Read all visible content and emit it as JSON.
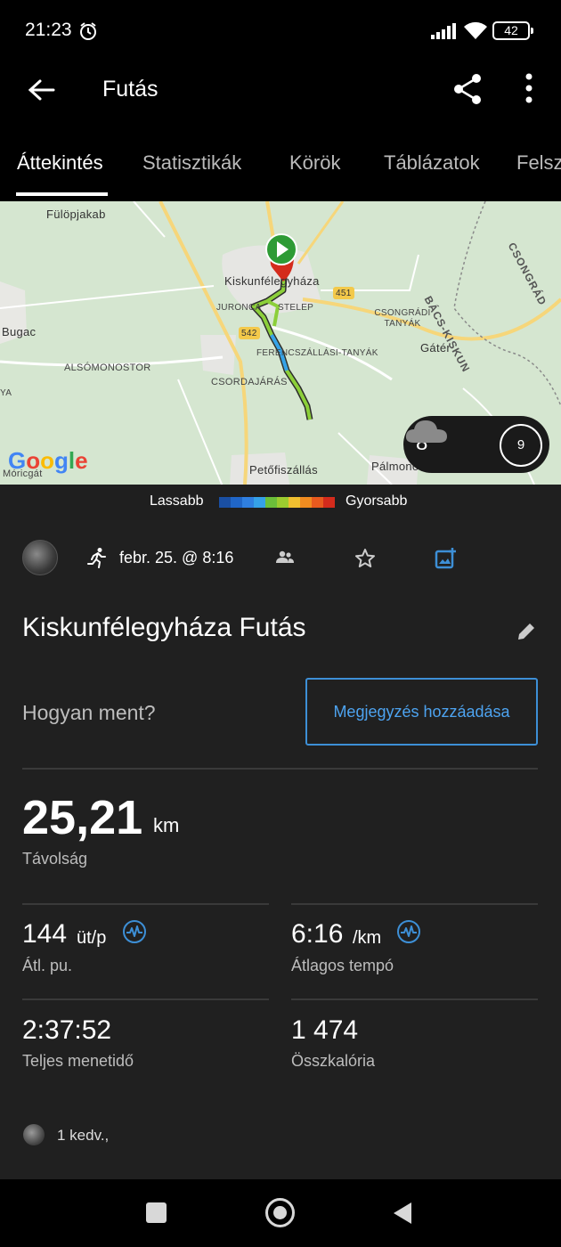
{
  "status": {
    "time": "21:23",
    "battery": "42",
    "alarm_icon": "alarm-clock-icon",
    "signal_icon": "signal-icon",
    "wifi_icon": "wifi-icon"
  },
  "appbar": {
    "title": "Futás",
    "back_icon": "arrow-left-icon",
    "share_icon": "share-icon",
    "more_icon": "more-vertical-icon"
  },
  "tabs": [
    {
      "label": "Áttekintés",
      "active": true
    },
    {
      "label": "Statisztikák",
      "active": false
    },
    {
      "label": "Körök",
      "active": false
    },
    {
      "label": "Táblázatok",
      "active": false
    },
    {
      "label": "Felsz",
      "active": false
    }
  ],
  "map": {
    "labels": {
      "fulopjakab": "Fülöpjakab",
      "kiskunfelegyhaza": "Kiskunfélegyháza",
      "juronca": "JURONCA",
      "telep": "STELEP",
      "bugac": "Bugac",
      "alsomonostor": "ALSÓMONOSTOR",
      "csordajaras": "CSORDAJÁRÁS",
      "ferencszallasi": "FERENCSZÁLLÁSI-TANYÁK",
      "csongradi_tanyak": "CSONGRÁDI TANYÁK",
      "gater": "Gátér",
      "petofiszallas": "Petőfiszállás",
      "palmonostora": "Pálmono",
      "moricgat": "Móricgát",
      "bacs_kiskun": "BÁCS-KISKUN",
      "csongrad": "CSONGRÁD",
      "road_451": "451",
      "road_542": "542",
      "ya": "YA"
    },
    "google_logo": "Google",
    "weather": {
      "temperature": "8°",
      "wind_speed": "9",
      "icon": "cloud-icon"
    }
  },
  "legend": {
    "slow": "Lassabb",
    "fast": "Gyorsabb",
    "colors": [
      "#1a4fa3",
      "#2066c8",
      "#2f7fe0",
      "#35a1e8",
      "#6bbf3a",
      "#9ccc2f",
      "#f0c030",
      "#f08c20",
      "#e85a1e",
      "#d42b1c"
    ]
  },
  "activity": {
    "date": "febr. 25. @ 8:16",
    "title": "Kiskunfélegyháza Futás",
    "how_label": "Hogyan ment?",
    "note_button": "Megjegyzés hozzáadása",
    "distance": {
      "value": "25,21",
      "unit": "km",
      "label": "Távolság"
    },
    "avg_hr": {
      "value": "144",
      "unit": "üt/p",
      "label": "Átl. pu."
    },
    "avg_pace": {
      "value": "6:16",
      "unit": "/km",
      "label": "Átlagos tempó"
    },
    "total_time": {
      "value": "2:37:52",
      "label": "Teljes menetidő"
    },
    "calories": {
      "value": "1 474",
      "label": "Összkalória"
    },
    "likes": "1 kedv.,"
  },
  "accent_color": "#3d8fd6"
}
